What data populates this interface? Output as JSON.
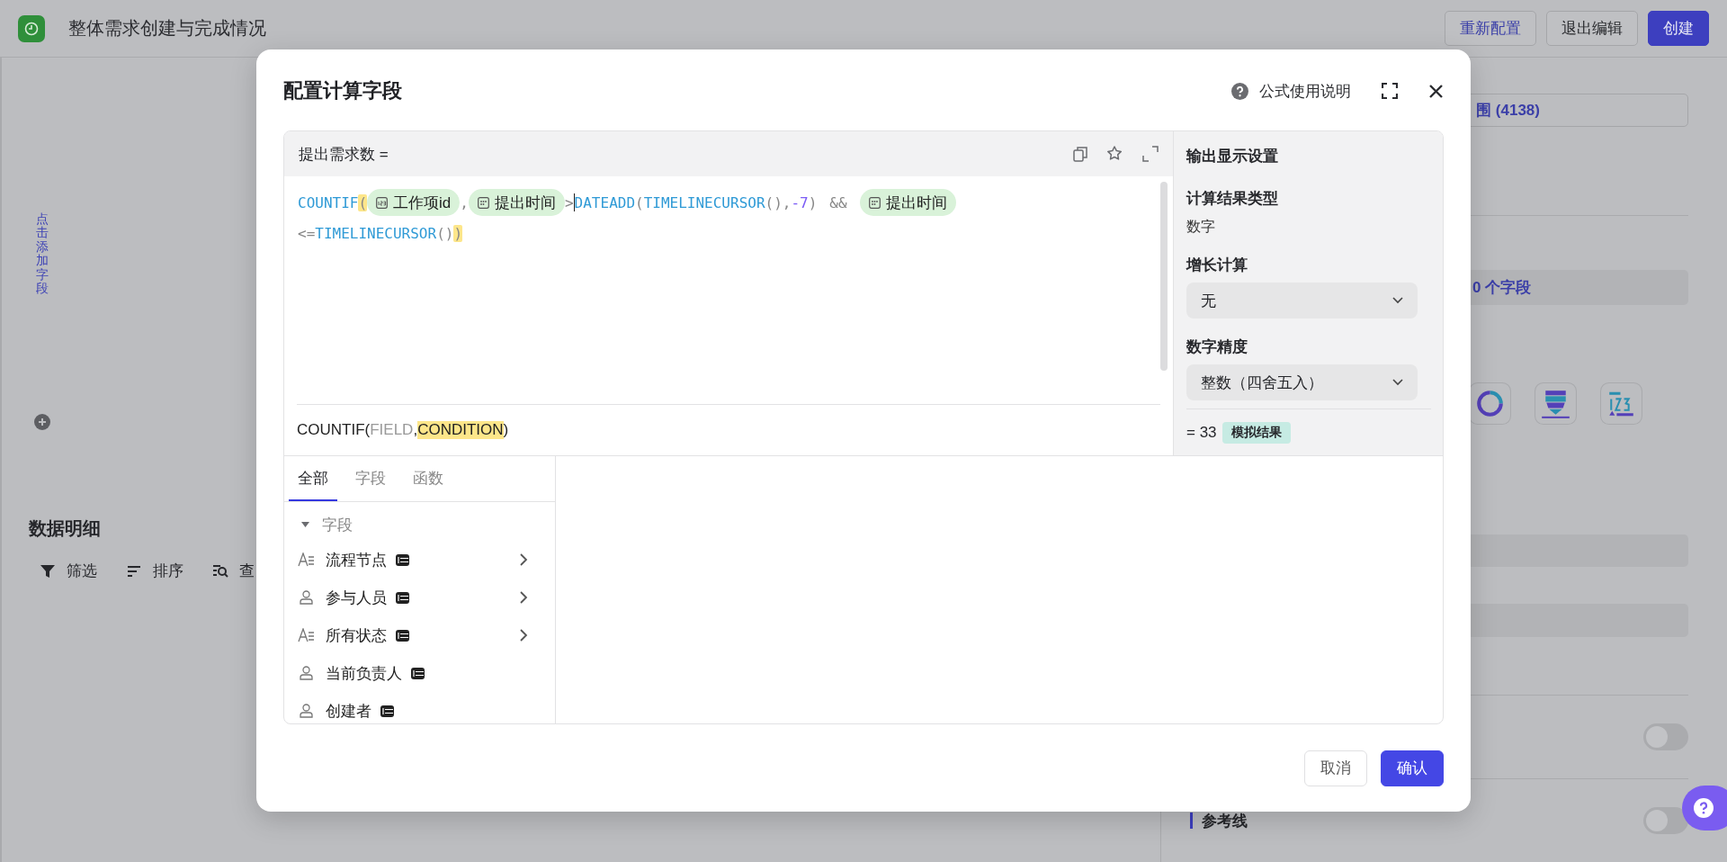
{
  "app_bar": {
    "title": "整体需求创建与完成情况",
    "buttons": [
      {
        "label": "重新配置",
        "kind": "link"
      },
      {
        "label": "退出编辑",
        "kind": "default"
      },
      {
        "label": "创建",
        "kind": "primary"
      }
    ]
  },
  "left_panel": {
    "add_field": "点击添加字段"
  },
  "details": {
    "title": "数据明细",
    "tools": [
      {
        "label": "筛选",
        "kind": "filter"
      },
      {
        "label": "排序",
        "kind": "sort"
      },
      {
        "label": "查",
        "kind": "search"
      }
    ]
  },
  "right_panel": {
    "range_text": "围 (4138)",
    "fields_text": "0 个字段",
    "chart_types": [
      {
        "kind": "donut"
      },
      {
        "kind": "funnel"
      },
      {
        "kind": "number"
      }
    ],
    "settings": [
      {
        "kind": "toggle",
        "on": false
      },
      {
        "kind": "toggle",
        "label": "参考线",
        "on": false
      }
    ]
  },
  "dialog": {
    "title": "配置计算字段",
    "help_link": "公式使用说明",
    "formula": {
      "name": "提出需求数 =",
      "lines": [
        [
          {
            "kind": "func",
            "text": "COUNTIF"
          },
          {
            "kind": "hl",
            "text": "("
          },
          {
            "kind": "number_field",
            "text": "工作项id"
          },
          {
            "kind": "punct",
            "text": ","
          },
          {
            "kind": "date_field",
            "text": "提出时间"
          },
          {
            "kind": "punct",
            "text": ">"
          },
          {
            "kind": "cursor"
          },
          {
            "kind": "func",
            "text": "DATEADD"
          },
          {
            "kind": "punct",
            "text": "("
          },
          {
            "kind": "func",
            "text": "TIMELINECURSOR"
          },
          {
            "kind": "punct",
            "text": "(),"
          },
          {
            "kind": "num",
            "text": "-7"
          },
          {
            "kind": "punct",
            "text": ")"
          },
          {
            "kind": "op",
            "text": "&&"
          },
          {
            "kind": "date_field",
            "text": "提出时间"
          }
        ],
        [
          {
            "kind": "punct",
            "text": "<="
          },
          {
            "kind": "func",
            "text": "TIMELINECURSOR"
          },
          {
            "kind": "punct",
            "text": "()"
          },
          {
            "kind": "hl",
            "text": ")"
          }
        ]
      ],
      "hint": [
        {
          "kind": "plain",
          "text": "COUNTIF("
        },
        {
          "kind": "arg",
          "text": "FIELD"
        },
        {
          "kind": "plain",
          "text": ", "
        },
        {
          "kind": "active",
          "text": "CONDITION"
        },
        {
          "kind": "plain",
          "text": ")"
        }
      ]
    },
    "output_settings": {
      "title": "输出显示设置",
      "result_type_label": "计算结果类型",
      "result_type": "数字",
      "growth": {
        "label": "增长计算",
        "value": "无"
      },
      "precision": {
        "label": "数字精度",
        "value": "整数（四舍五入）"
      },
      "result": "= 33",
      "result_tag": "模拟结果"
    },
    "library": {
      "tabs": [
        {
          "label": "全部",
          "selected": true
        },
        {
          "label": "字段",
          "selected": false
        },
        {
          "label": "函数",
          "selected": false
        }
      ],
      "section": {
        "label": "字段",
        "expanded": true,
        "items": [
          {
            "kind": "text",
            "name": "流程节点",
            "expandable": true
          },
          {
            "kind": "person",
            "name": "参与人员",
            "expandable": true
          },
          {
            "kind": "text",
            "name": "所有状态",
            "expandable": true
          },
          {
            "kind": "person",
            "name": "当前负责人",
            "expandable": false
          },
          {
            "kind": "person",
            "name": "创建者",
            "expandable": false
          }
        ]
      }
    },
    "buttons": [
      {
        "label": "取消",
        "kind": "default"
      },
      {
        "label": "确认",
        "kind": "primary"
      }
    ]
  }
}
